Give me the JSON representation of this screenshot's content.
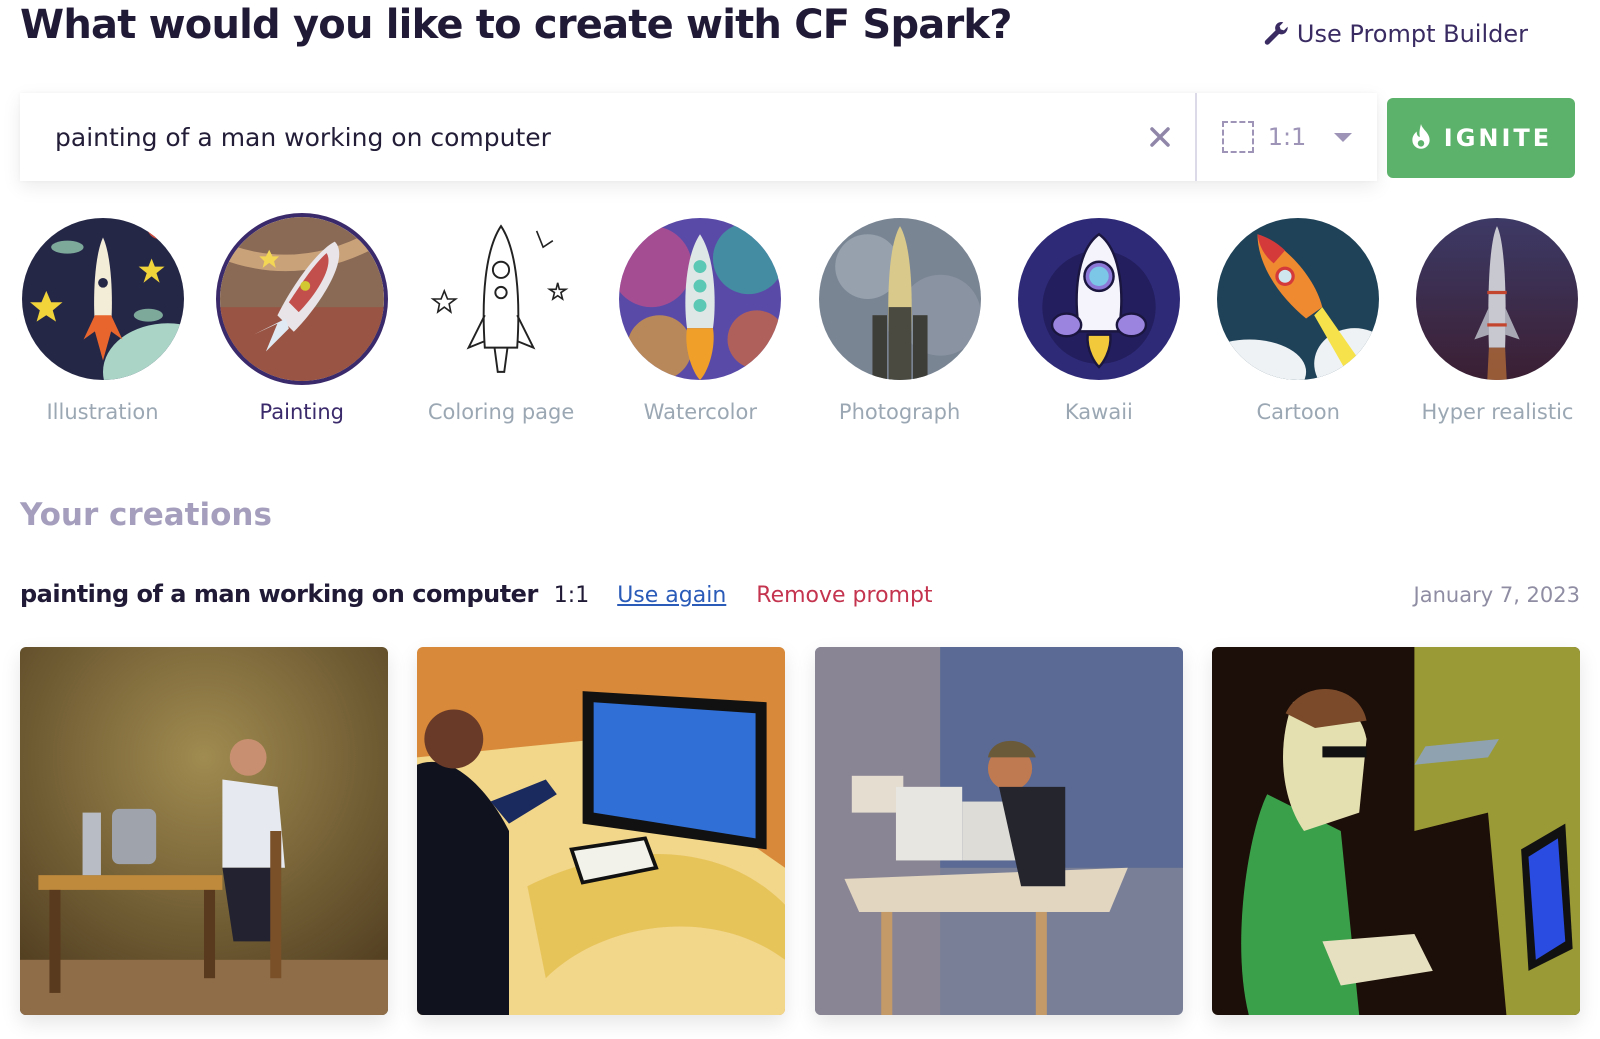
{
  "header": {
    "title": "What would you like to create with CF Spark?",
    "prompt_builder_label": "Use Prompt Builder",
    "prompt_builder_icon": "wrench-icon"
  },
  "search": {
    "value": "painting of a man working on computer",
    "clear_icon": "close-icon",
    "aspect_ratio": "1:1",
    "aspect_icon": "dashed-square-icon",
    "dropdown_icon": "caret-down-icon"
  },
  "ignite_button": {
    "label": "IGNITE",
    "icon": "flame-icon",
    "color": "#5db26b"
  },
  "styles": {
    "selected": "Painting",
    "items": [
      {
        "label": "Illustration",
        "selected": false
      },
      {
        "label": "Painting",
        "selected": true
      },
      {
        "label": "Coloring page",
        "selected": false
      },
      {
        "label": "Watercolor",
        "selected": false
      },
      {
        "label": "Photograph",
        "selected": false
      },
      {
        "label": "Kawaii",
        "selected": false
      },
      {
        "label": "Cartoon",
        "selected": false
      },
      {
        "label": "Hyper realistic",
        "selected": false
      }
    ]
  },
  "creations": {
    "section_title": "Your creations",
    "groups": [
      {
        "prompt": "painting of a man working on computer",
        "ratio": "1:1",
        "use_again_label": "Use again",
        "remove_label": "Remove prompt",
        "date": "January 7, 2023",
        "images": [
          {
            "description": "realistic oil painting of man in white shirt typing at desk"
          },
          {
            "description": "bold stylized painting of man at desk with blue monitor"
          },
          {
            "description": "impressionist painting of man in cap at cluttered desk"
          },
          {
            "description": "digital painting of young man with glasses in green sweater"
          }
        ]
      }
    ]
  },
  "colors": {
    "title": "#211a36",
    "accent_purple": "#3b2a6b",
    "link_blue": "#2a5bb8",
    "remove_red": "#c4344f",
    "muted_label": "#9ba8b4"
  }
}
